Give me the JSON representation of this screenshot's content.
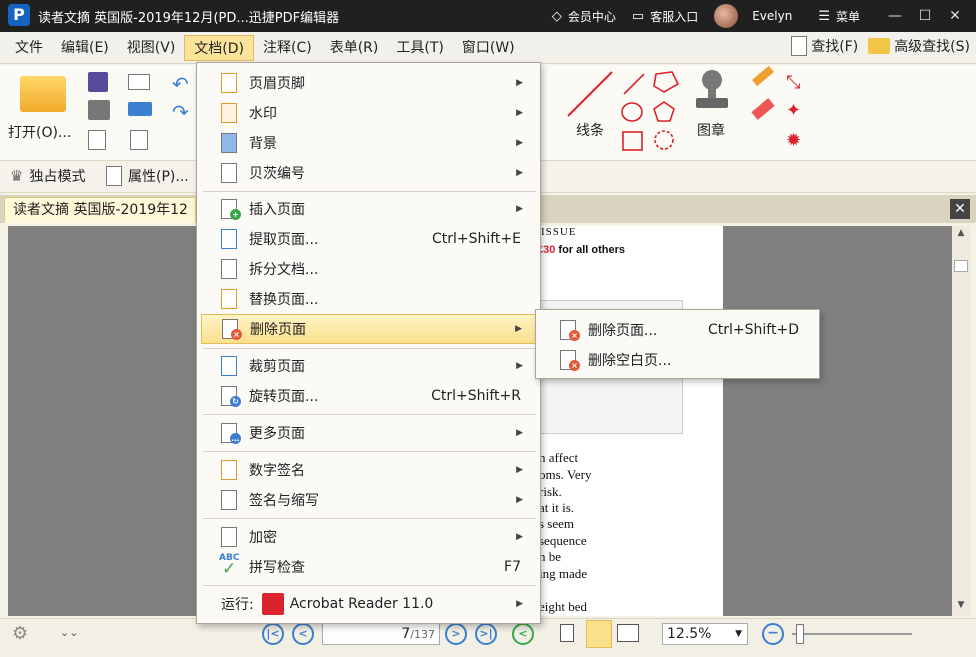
{
  "titlebar": {
    "app_logo_letter": "P",
    "title": "读者文摘 英国版-2019年12月(PD...迅捷PDF编辑器",
    "member_center": "会员中心",
    "customer_service": "客服入口",
    "user_name": "Evelyn",
    "menu_label": "菜单",
    "minimize": "—",
    "maximize": "☐",
    "close": "✕"
  },
  "menubar": {
    "items": [
      "文件",
      "编辑(E)",
      "视图(V)",
      "文档(D)",
      "注释(C)",
      "表单(R)",
      "工具(T)",
      "窗口(W)"
    ],
    "find": "查找(F)",
    "advanced_find": "高级查找(S)"
  },
  "ribbon": {
    "open_label": "打开(O)...",
    "line_label": "线条",
    "stamp_label": "图章",
    "exclusive_mode": "独占模式",
    "properties": "属性(P)..."
  },
  "doc_tab": {
    "title": "读者文摘 英国版-2019年12",
    "close": "✕"
  },
  "doc_menu": {
    "items": [
      {
        "label": "页眉页脚",
        "shortcut": "",
        "submenu": true
      },
      {
        "label": "水印",
        "shortcut": "",
        "submenu": true
      },
      {
        "label": "背景",
        "shortcut": "",
        "submenu": true
      },
      {
        "label": "贝茨编号",
        "shortcut": "",
        "submenu": true
      },
      {
        "label": "插入页面",
        "shortcut": "",
        "submenu": true
      },
      {
        "label": "提取页面...",
        "shortcut": "Ctrl+Shift+E",
        "submenu": false
      },
      {
        "label": "拆分文档...",
        "shortcut": "",
        "submenu": false
      },
      {
        "label": "替换页面...",
        "shortcut": "",
        "submenu": false
      },
      {
        "label": "删除页面",
        "shortcut": "",
        "submenu": true
      },
      {
        "label": "裁剪页面",
        "shortcut": "",
        "submenu": true
      },
      {
        "label": "旋转页面...",
        "shortcut": "Ctrl+Shift+R",
        "submenu": false
      },
      {
        "label": "更多页面",
        "shortcut": "",
        "submenu": true
      },
      {
        "label": "数字签名",
        "shortcut": "",
        "submenu": true
      },
      {
        "label": "签名与缩写",
        "shortcut": "",
        "submenu": true
      },
      {
        "label": "加密",
        "shortcut": "",
        "submenu": true
      },
      {
        "label": "拼写检查",
        "shortcut": "F7",
        "submenu": false
      },
      {
        "label": "运行:",
        "shortcut": "",
        "submenu": true
      }
    ],
    "run_target": "Acrobat Reader 11.0",
    "spell_icon_text": "ABC"
  },
  "delete_submenu": {
    "items": [
      {
        "label": "删除页面...",
        "shortcut": "Ctrl+Shift+D"
      },
      {
        "label": "删除空白页..."
      }
    ]
  },
  "page_content": {
    "issue": "ISSUE",
    "price_prefix": "£30",
    "price_rest": " for all others",
    "lines": [
      "n affect",
      "oms. Very",
      "risk.",
      "at it is.",
      "s seem",
      "sequence",
      "n be",
      "ing made",
      "eight bed"
    ]
  },
  "statusbar": {
    "current_page": "7",
    "total_pages": "/137",
    "zoom": "12.5%"
  },
  "colors": {
    "titlebar_bg": "#202020",
    "menu_highlight": "#fbe08c",
    "accent_blue": "#3b7fd0",
    "delete_badge": "#e05a3a",
    "add_badge": "#3aa84a"
  }
}
